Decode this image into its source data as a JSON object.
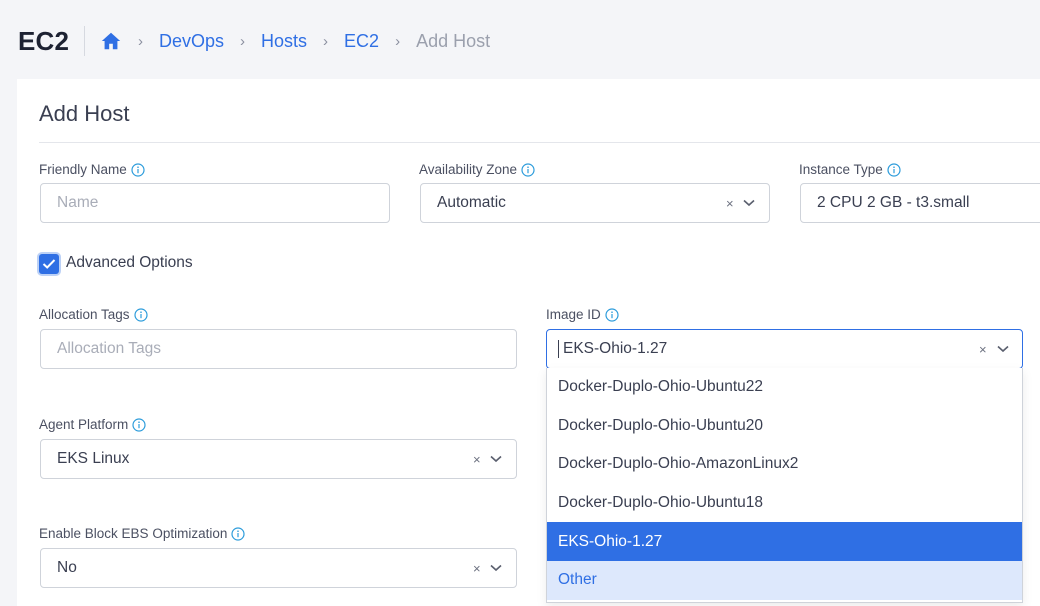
{
  "header": {
    "title": "EC2",
    "breadcrumb": [
      "DevOps",
      "Hosts",
      "EC2"
    ],
    "breadcrumb_current": "Add Host",
    "separator": "›"
  },
  "form": {
    "title": "Add Host",
    "friendly_name": {
      "label": "Friendly Name",
      "placeholder": "Name",
      "value": ""
    },
    "availability_zone": {
      "label": "Availability Zone",
      "value": "Automatic"
    },
    "instance_type": {
      "label": "Instance Type",
      "value": "2 CPU 2 GB - t3.small"
    },
    "advanced_options": {
      "label": "Advanced Options",
      "checked": true
    },
    "allocation_tags": {
      "label": "Allocation Tags",
      "placeholder": "Allocation Tags",
      "value": ""
    },
    "image_id": {
      "label": "Image ID",
      "value": "EKS-Ohio-1.27",
      "options": [
        "Docker-Duplo-Ohio-Ubuntu22",
        "Docker-Duplo-Ohio-Ubuntu20",
        "Docker-Duplo-Ohio-AmazonLinux2",
        "Docker-Duplo-Ohio-Ubuntu18",
        "EKS-Ohio-1.27",
        "Other"
      ],
      "selected_option": "EKS-Ohio-1.27",
      "hovered_option": "Other"
    },
    "agent_platform": {
      "label": "Agent Platform",
      "value": "EKS Linux"
    },
    "ebs_optimization": {
      "label": "Enable Block EBS Optimization",
      "value": "No"
    },
    "clear_symbol": "×"
  },
  "colors": {
    "accent": "#2f6fe4",
    "info_icon": "#2d9cdb",
    "hover": "#dde8fc"
  }
}
